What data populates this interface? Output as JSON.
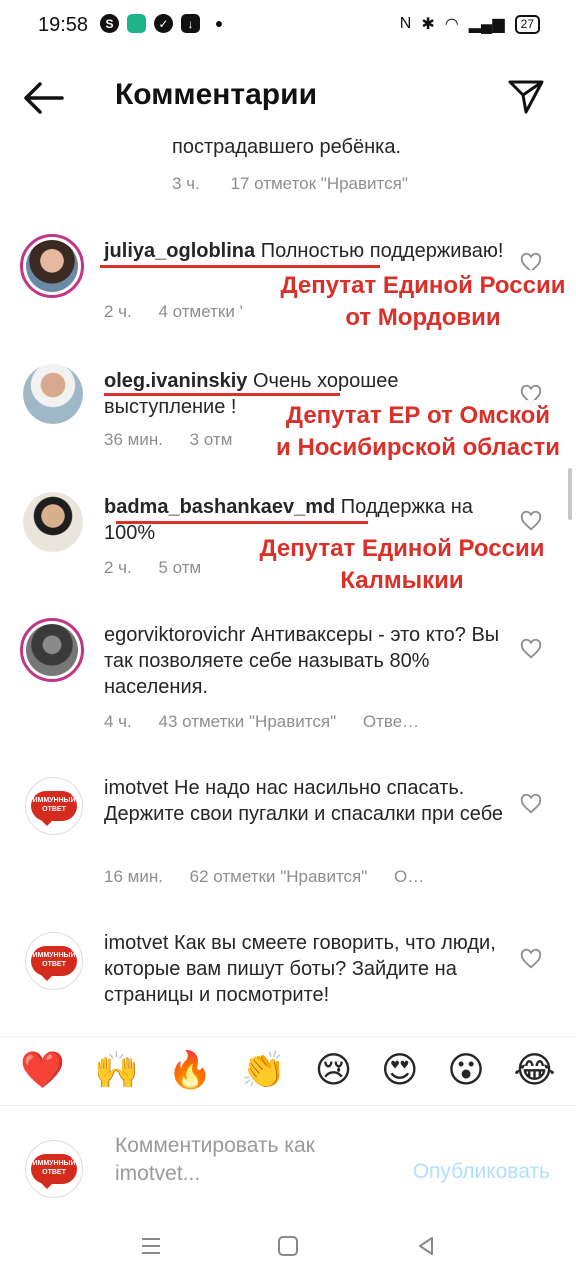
{
  "status": {
    "time": "19:58",
    "battery": "27"
  },
  "header": {
    "title": "Комментарии"
  },
  "top_comment": {
    "text": "пострадавшего ребёнка.",
    "time": "3 ч.",
    "likes": "17 отметок \"Нравится\""
  },
  "comments": [
    {
      "username": "juliya_ogloblina",
      "text": "Полностью поддерживаю!",
      "time": "2 ч.",
      "likes": "4 отметки '",
      "annotation": [
        "Депутат Единой России",
        "от Мордовии"
      ]
    },
    {
      "username": "oleg.ivaninskiy",
      "text": "Очень хорошее выступление !",
      "time": "36 мин.",
      "likes": "3 отм",
      "annotation": [
        "Депутат ЕР от Омской",
        "и Носибирской области"
      ]
    },
    {
      "username": "badma_bashankaev_md",
      "text": "Поддержка на 100%",
      "time": "2 ч.",
      "likes": "5 отм",
      "annotation": [
        "Депутат Единой России",
        "Калмыкии"
      ]
    },
    {
      "username": "egorviktorovichr",
      "text": "Антиваксеры - это кто? Вы так позволяете себе называть 80% населения.",
      "time": "4 ч.",
      "likes": "43 отметки \"Нравится\"",
      "reply": "Отве…"
    },
    {
      "username": "imotvet",
      "text": "Не надо нас насильно спасать. Держите свои пугалки и спасалки при себе",
      "time": "16 мин.",
      "likes": "62 отметки \"Нравится\"",
      "reply": "О…"
    },
    {
      "username": "imotvet",
      "text": "Как вы смеете говорить, что люди, которые вам пишут боты? Зайдите на страницы и посмотрите!",
      "time": "",
      "likes": "",
      "reply": ""
    }
  ],
  "logo_text": "ИММУННЫЙ ОТВЕТ",
  "emojis": [
    "❤️",
    "🙌",
    "🔥",
    "👏",
    "😢",
    "😍",
    "😮",
    "😂"
  ],
  "composer": {
    "placeholder": "Комментировать как imotvet...",
    "publish": "Опубликовать"
  },
  "colors": {
    "annotation": "#d9302a",
    "story_ring": "#c13584",
    "publish": "#b2dffc",
    "logo": "#d52b1e"
  }
}
